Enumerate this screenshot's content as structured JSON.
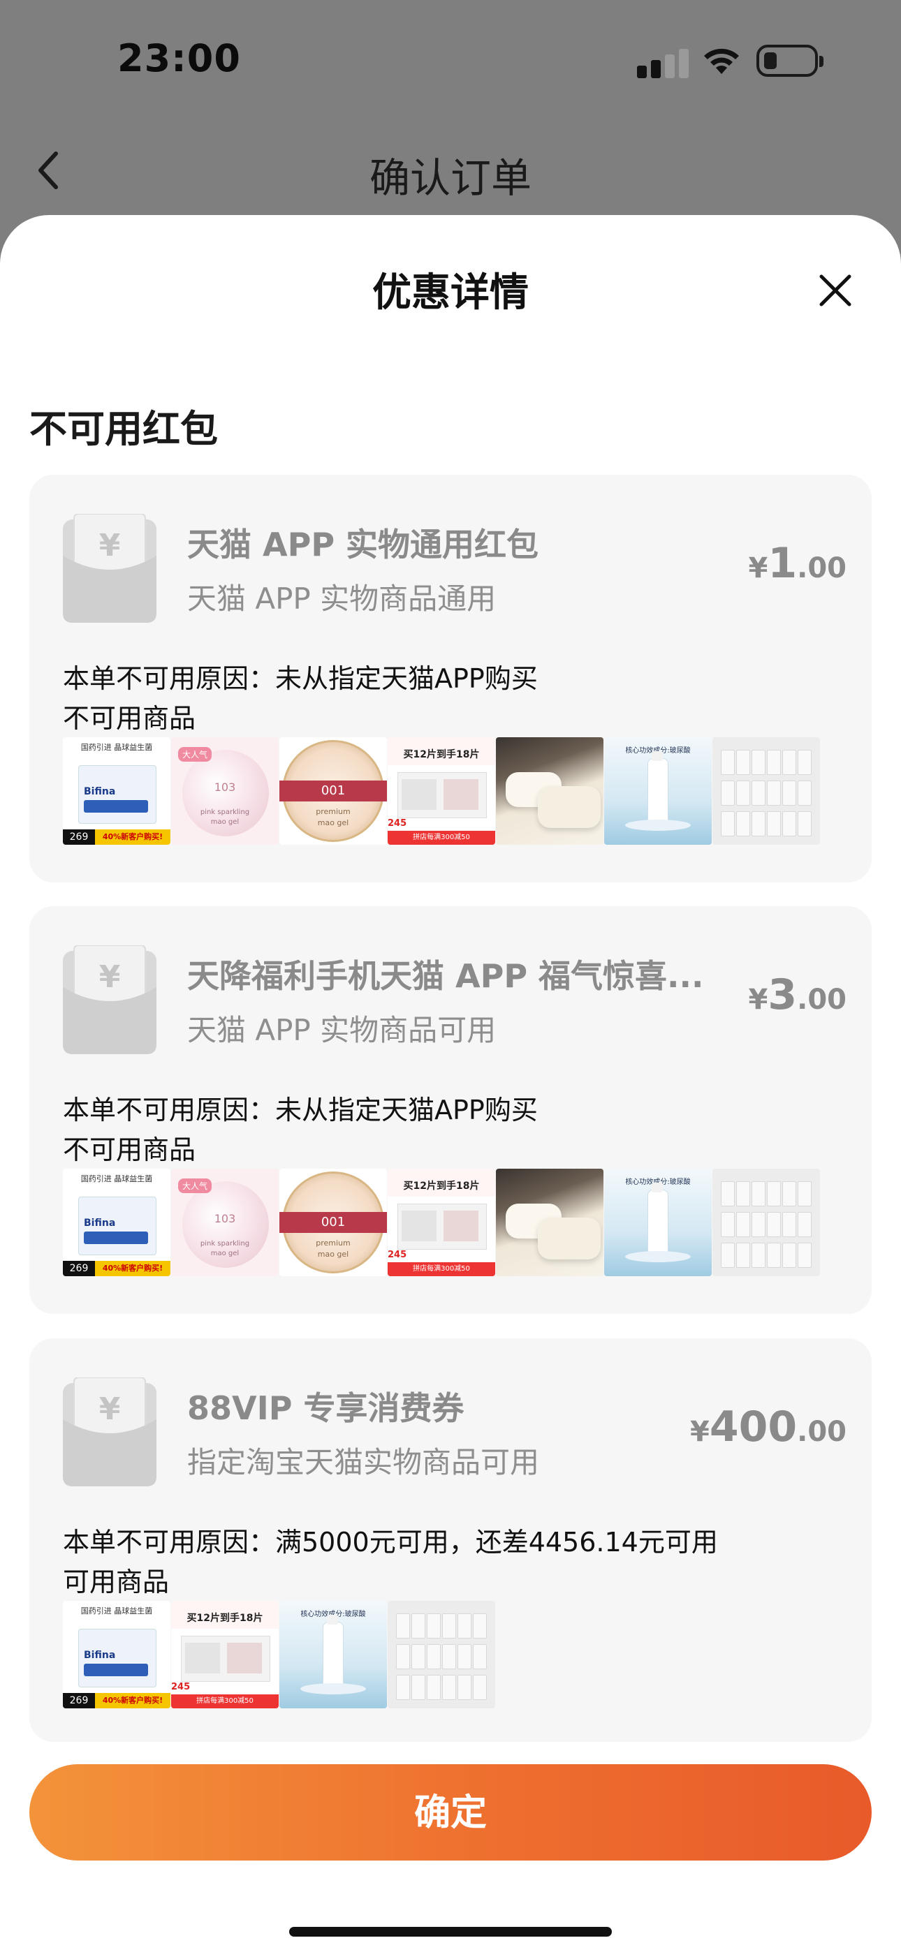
{
  "status_bar": {
    "time": "23:00"
  },
  "nav": {
    "title": "确认订单"
  },
  "sheet": {
    "title": "优惠详情",
    "section_title": "不可用红包",
    "confirm_label": "确定"
  },
  "cards": [
    {
      "title": "天猫 APP 实物通用红包",
      "subtitle": "天猫 APP 实物商品通用",
      "currency": "¥",
      "amount_int": "1",
      "amount_dec": ".00",
      "reason": "本单不可用原因：未从指定天猫APP购买",
      "unavailable_label": "不可用商品",
      "thumbs": [
        "t1",
        "t2",
        "t3",
        "t4",
        "t5",
        "t6",
        "t7"
      ]
    },
    {
      "title": "天降福利手机天猫 APP 福气惊喜...",
      "subtitle": "天猫 APP 实物商品可用",
      "currency": "¥",
      "amount_int": "3",
      "amount_dec": ".00",
      "reason": "本单不可用原因：未从指定天猫APP购买",
      "unavailable_label": "不可用商品",
      "thumbs": [
        "t1",
        "t2",
        "t3",
        "t4",
        "t5",
        "t6",
        "t7"
      ]
    },
    {
      "title": "88VIP 专享消费券",
      "subtitle": "指定淘宝天猫实物商品可用",
      "currency": "¥",
      "amount_int": "400",
      "amount_dec": ".00",
      "reason": "本单不可用原因：满5000元可用，还差4456.14元可用",
      "unavailable_label": "可用商品",
      "thumbs": [
        "t1",
        "t4",
        "t6",
        "t7"
      ]
    }
  ],
  "thumb_text": {
    "t1": {
      "top": "国药引进 晶球益生菌",
      "brand": "Bifina",
      "price": "269",
      "tag": "40%新客户购买!"
    },
    "t2": {
      "badge": "大人气",
      "num": "103",
      "sub": "pink sparkling",
      "sub2": "mao gel"
    },
    "t3a": {
      "num": "001",
      "sub": "premium",
      "sub2": "mao gel"
    },
    "t4": {
      "headline": "买12片到手18片",
      "price": "245",
      "foot": "拼店每满300减50"
    },
    "t6": {
      "headline": "核心功效成分:玻尿酸"
    }
  },
  "colors": {
    "accent_start": "#f3933a",
    "accent_end": "#e85a2a",
    "card_bg": "#f6f6f6",
    "muted_text": "#8a8a8a"
  },
  "icons": [
    "back-chevron-icon",
    "close-icon",
    "red-envelope-icon",
    "wifi-icon",
    "battery-icon",
    "signal-icon"
  ]
}
